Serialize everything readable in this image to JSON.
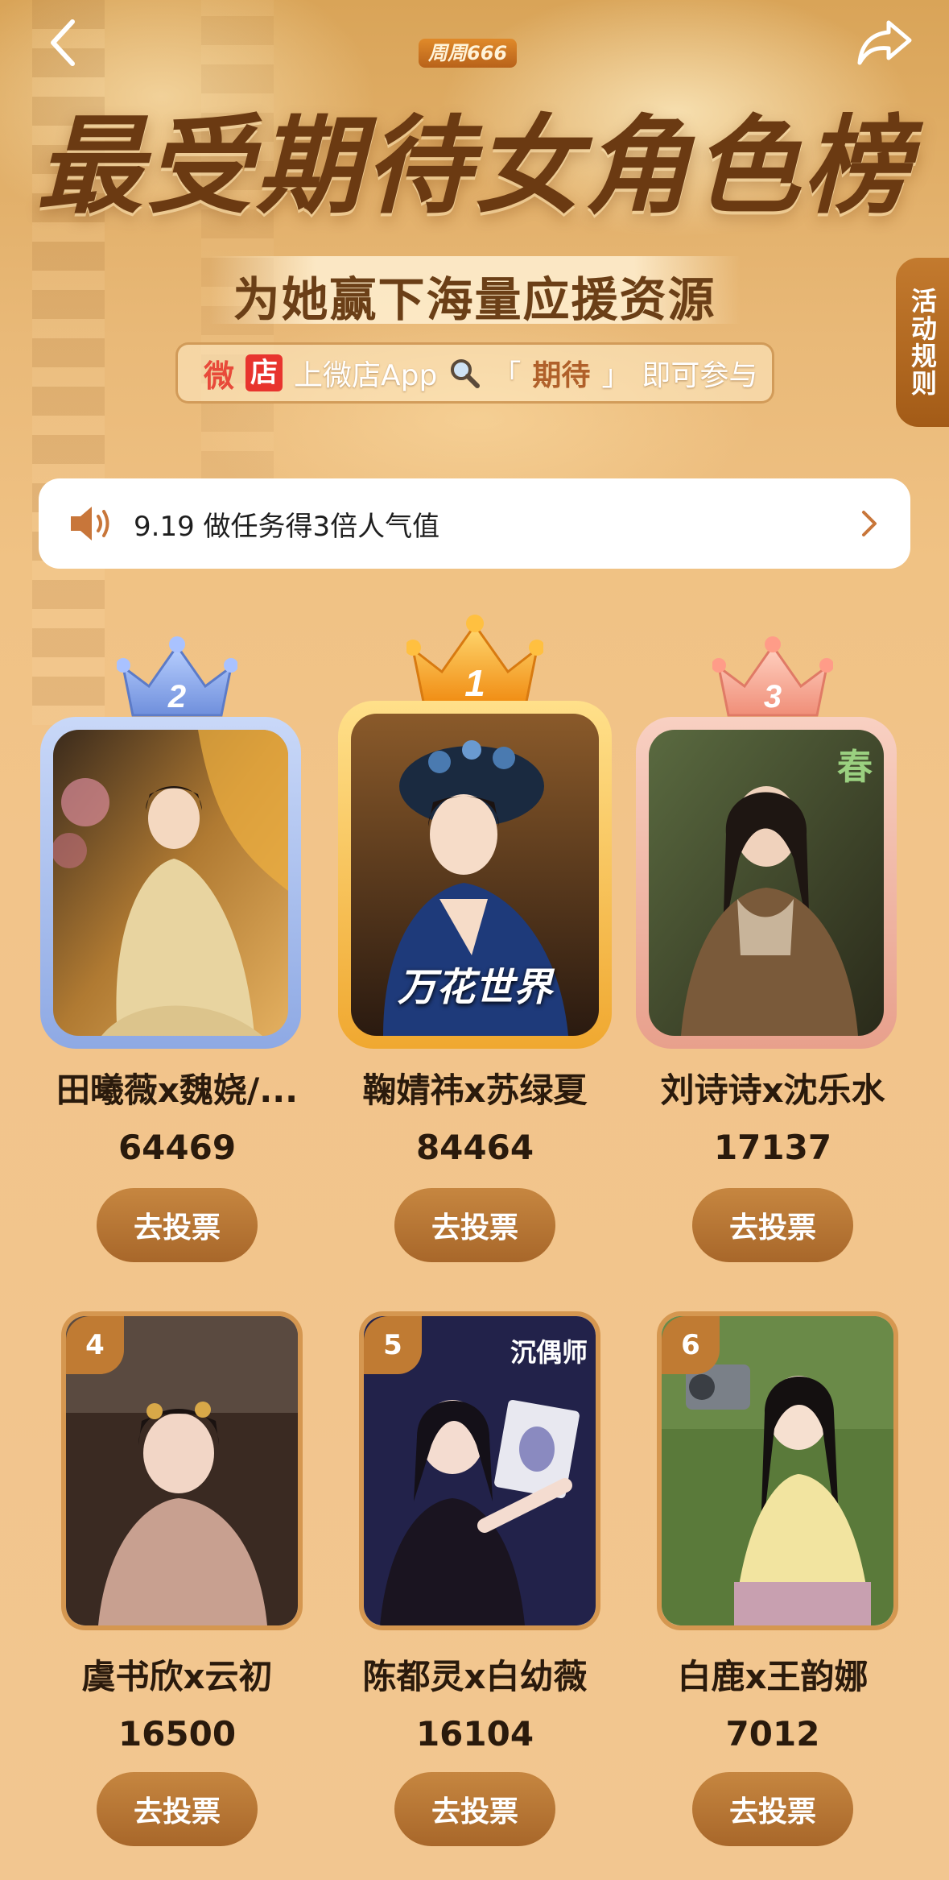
{
  "header": {
    "brand": "周周666",
    "title": "最受期待女角色榜",
    "subtitle": "为她赢下海量应援资源",
    "app_hint": {
      "wei": "微",
      "dian": "店",
      "prefix": "上微店App",
      "open_quote": "「",
      "keyword": "期待",
      "close_quote": "」",
      "suffix": "即可参与"
    },
    "rules_label": "活动规则"
  },
  "notice": {
    "text": "9.19 做任务得3倍人气值"
  },
  "top3": [
    {
      "rank": "2",
      "name": "田曦薇x魏娆/...",
      "score": "64469",
      "vote_label": "去投票",
      "color": "#8aa7e6"
    },
    {
      "rank": "1",
      "name": "鞠婧祎x苏绿夏",
      "score": "84464",
      "vote_label": "去投票",
      "color": "#f2b23a",
      "poster_text": "万花世界"
    },
    {
      "rank": "3",
      "name": "刘诗诗x沈乐水",
      "score": "17137",
      "vote_label": "去投票",
      "color": "#eeb09a",
      "poster_text": "春"
    }
  ],
  "others": [
    {
      "rank": "4",
      "name": "虞书欣x云初",
      "score": "16500",
      "vote_label": "去投票"
    },
    {
      "rank": "5",
      "name": "陈都灵x白幼薇",
      "score": "16104",
      "vote_label": "去投票",
      "poster_text": "沉偶师"
    },
    {
      "rank": "6",
      "name": "白鹿x王韵娜",
      "score": "7012",
      "vote_label": "去投票"
    }
  ],
  "colors": {
    "accent": "#b8752f",
    "title": "#6b3a12",
    "silver": "#8aa7e6",
    "gold": "#f2b23a",
    "bronze": "#eeb09a"
  },
  "icons": [
    "back-arrow-icon",
    "share-icon",
    "speaker-icon",
    "chevron-right-icon",
    "crown-icon"
  ]
}
